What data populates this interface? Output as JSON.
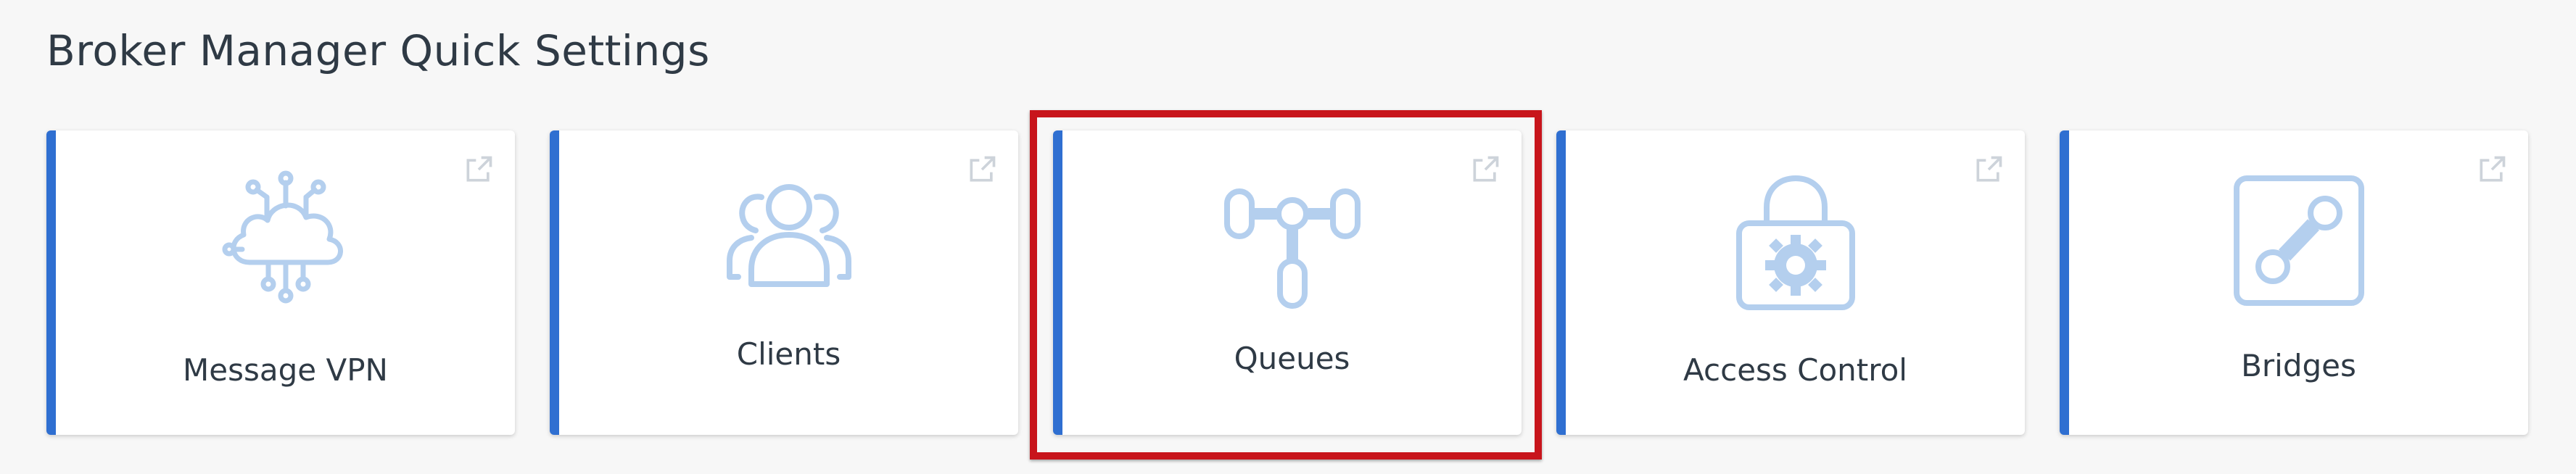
{
  "section": {
    "title": "Broker Manager Quick Settings"
  },
  "colors": {
    "accent": "#2f6fd1",
    "icon": "#b4cfee",
    "highlight": "#c8151c",
    "text": "#2f3a45"
  },
  "cards": [
    {
      "label": "Message VPN",
      "icon": "cloud-network-icon",
      "external_icon": "external-link-icon"
    },
    {
      "label": "Clients",
      "icon": "users-icon",
      "external_icon": "external-link-icon"
    },
    {
      "label": "Queues",
      "icon": "queue-topology-icon",
      "external_icon": "external-link-icon",
      "highlighted": true
    },
    {
      "label": "Access Control",
      "icon": "lock-gear-icon",
      "external_icon": "external-link-icon"
    },
    {
      "label": "Bridges",
      "icon": "bridge-icon",
      "external_icon": "external-link-icon"
    }
  ]
}
